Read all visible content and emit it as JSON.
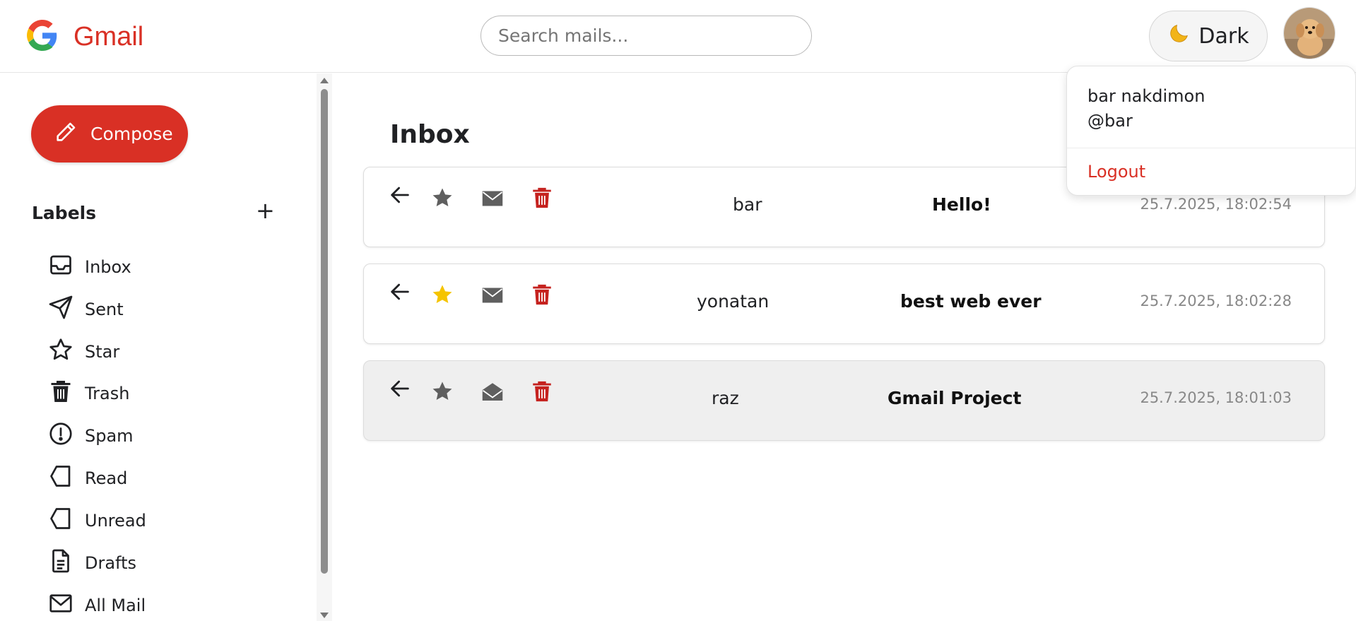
{
  "header": {
    "brand": "Gmail",
    "search_placeholder": "Search mails...",
    "theme_button_label": "Dark",
    "theme_button_icon": "moon-icon"
  },
  "sidebar": {
    "compose_label": "Compose",
    "labels_title": "Labels",
    "add_label_symbol": "+",
    "items": [
      {
        "label": "Inbox",
        "icon": "inbox-icon"
      },
      {
        "label": "Sent",
        "icon": "send-icon"
      },
      {
        "label": "Star",
        "icon": "star-icon"
      },
      {
        "label": "Trash",
        "icon": "trash-icon"
      },
      {
        "label": "Spam",
        "icon": "spam-icon"
      },
      {
        "label": "Read",
        "icon": "tag-icon"
      },
      {
        "label": "Unread",
        "icon": "tag-icon"
      },
      {
        "label": "Drafts",
        "icon": "draft-icon"
      },
      {
        "label": "All Mail",
        "icon": "mail-icon"
      }
    ]
  },
  "main": {
    "title": "Inbox",
    "mails": [
      {
        "sender": "bar",
        "subject": "Hello!",
        "date": "25.7.2025, 18:02:54",
        "starred": false,
        "read": false
      },
      {
        "sender": "yonatan",
        "subject": "best web ever",
        "date": "25.7.2025, 18:02:28",
        "starred": true,
        "read": false
      },
      {
        "sender": "raz",
        "subject": "Gmail Project",
        "date": "25.7.2025, 18:01:03",
        "starred": false,
        "read": true
      }
    ]
  },
  "user_menu": {
    "name": "bar nakdimon",
    "handle": "@bar",
    "logout_label": "Logout"
  },
  "colors": {
    "accent_red": "#d93025",
    "star_active": "#f5c400",
    "star_inactive": "#5f5f5f",
    "trash_red": "#c5221f"
  }
}
